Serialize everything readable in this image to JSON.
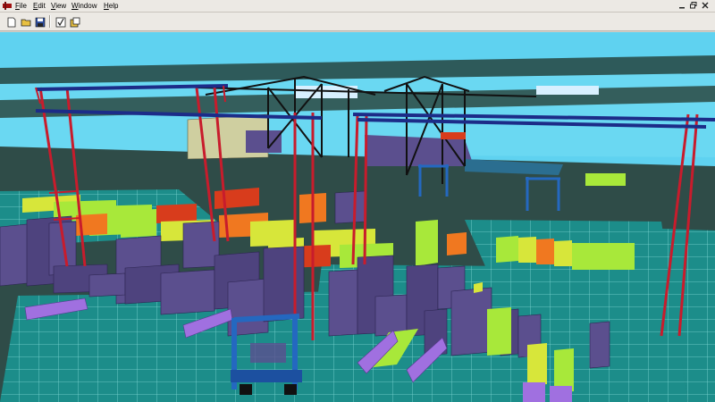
{
  "window": {
    "menus": [
      "File",
      "Edit",
      "View",
      "Window",
      "Help"
    ],
    "controls": [
      "minimize-icon",
      "restore-icon",
      "close-icon"
    ]
  },
  "toolbar": {
    "buttons": [
      "new-file-icon",
      "open-folder-icon",
      "save-icon",
      "checklist-icon",
      "export-icon"
    ]
  },
  "scene": {
    "description_icons": [
      "gantry-crane",
      "ship-to-shore-crane",
      "straddle-carrier",
      "container-stack"
    ],
    "colors": {
      "sky": "#5fd2f0",
      "ground": "#2f4c48",
      "yard_grid": "#1f8f8c",
      "container_purple": "#5b4f8e",
      "container_lime": "#a8e83a",
      "container_yellow": "#d7e63a",
      "container_orange": "#f07820",
      "container_red": "#d83c1c",
      "container_lavender": "#a070e0",
      "crane_red": "#c81c2c",
      "crane_blue": "#1c2c88",
      "vehicle_blue": "#2468c0"
    }
  }
}
